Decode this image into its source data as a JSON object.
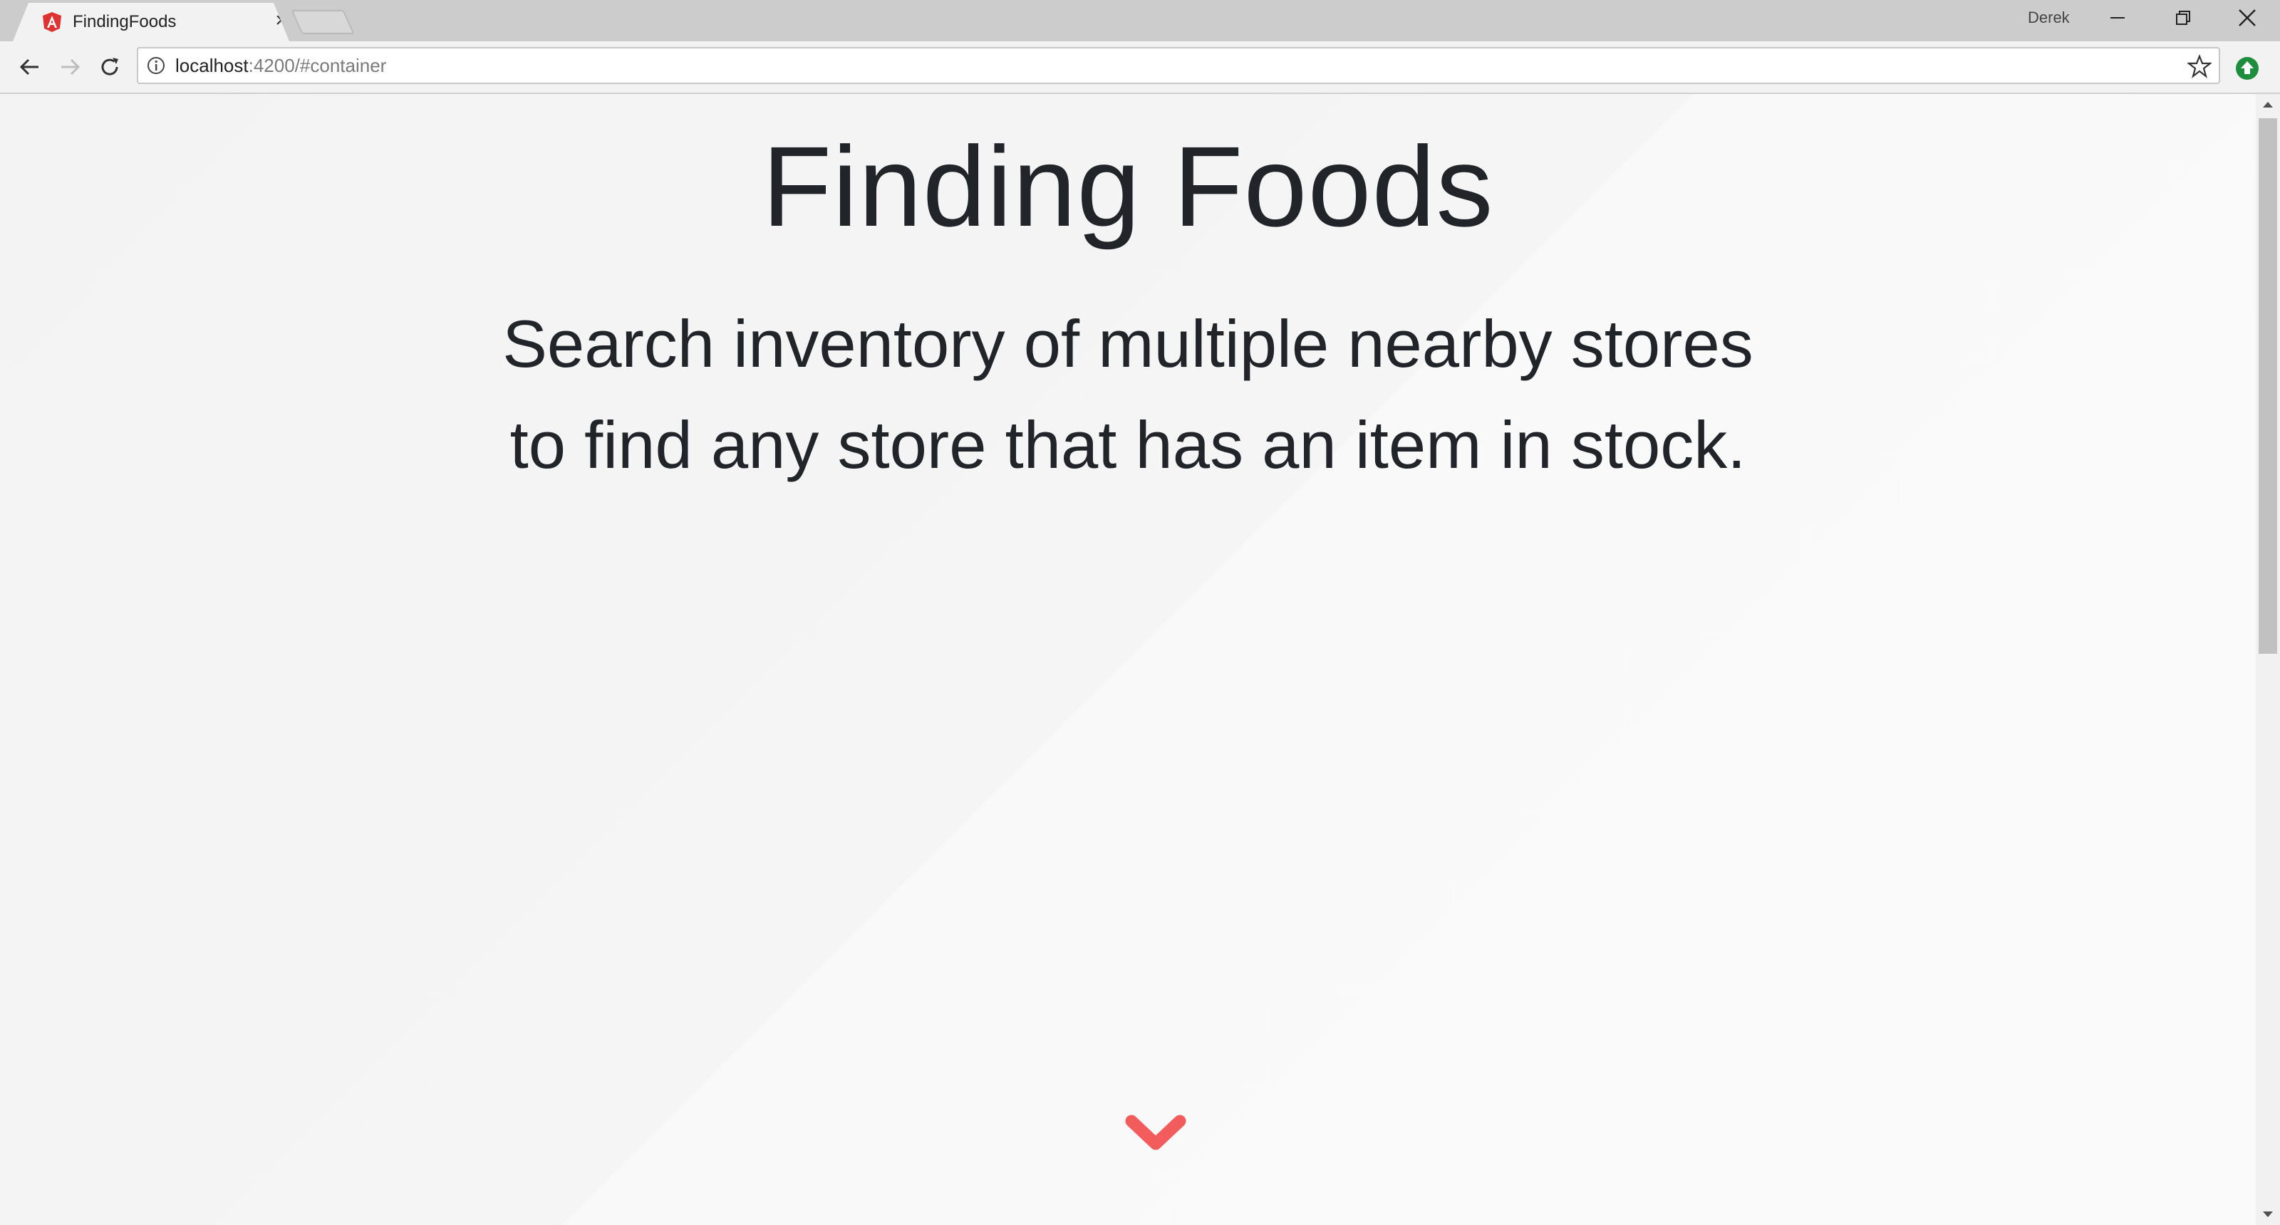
{
  "browser": {
    "tab": {
      "title": "FindingFoods",
      "favicon": "angular-icon",
      "close_icon": "close-icon"
    },
    "profile_name": "Derek",
    "window_controls": [
      "minimize-icon",
      "restore-icon",
      "close-icon"
    ],
    "nav": [
      "back-arrow-icon",
      "forward-arrow-icon",
      "reload-icon"
    ],
    "address": {
      "host": "localhost",
      "rest": ":4200/#container"
    },
    "colors": {
      "tab_strip": "#cccccc",
      "toolbar": "#f2f2f2",
      "extension": "#1e8e3e"
    }
  },
  "page": {
    "title": "Finding Foods",
    "lead_line_1": "Search inventory of multiple nearby stores",
    "lead_line_2": "to find any store that has an item in stock.",
    "scroll_icon": "chevron-down-icon",
    "accent_color": "#f25c5c",
    "text_color": "#212529"
  }
}
